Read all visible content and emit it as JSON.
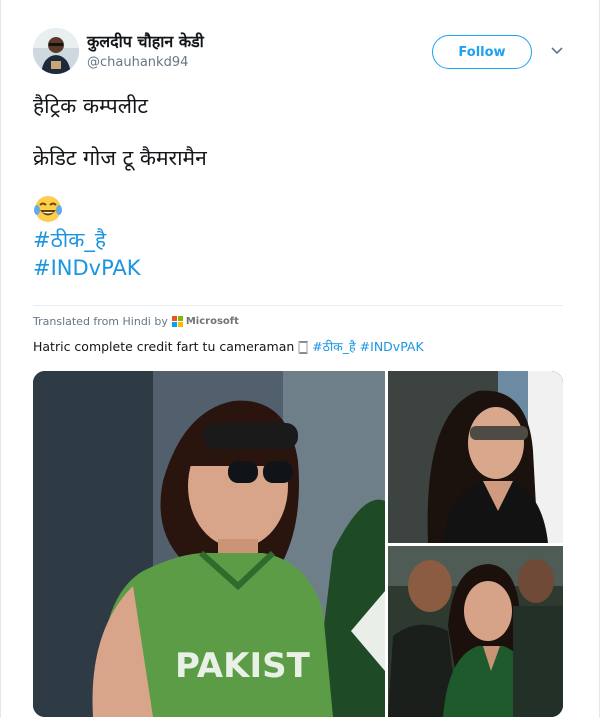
{
  "tweet": {
    "display_name": "कुलदीप चौहान केडी",
    "handle": "@chauhankd94",
    "follow_label": "Follow",
    "text_line1": "हैट्रिक कम्पलीट",
    "text_line2": "क्रेडिट गोज टू कैमरामैन",
    "hashtag1": "#ठीक_है",
    "hashtag2": "#INDvPAK"
  },
  "translation": {
    "translated_from": "Translated from Hindi by",
    "provider": "Microsoft",
    "text": "Hatric complete credit fart tu cameraman 🀆 ",
    "tag1": "#ठीक_है",
    "tag2": "#INDvPAK"
  },
  "media": {
    "jersey_text": "PAKIST"
  },
  "icons": {
    "emoji": "laughing-tears-emoji-icon",
    "caret": "chevron-down-icon"
  },
  "colors": {
    "link": "#1b95e0",
    "follow": "#1da1f2"
  }
}
